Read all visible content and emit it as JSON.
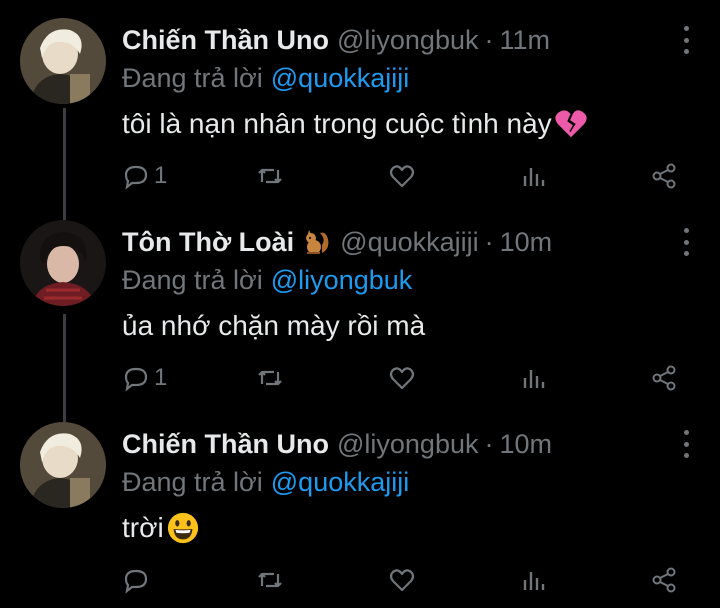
{
  "tweets": [
    {
      "display_name": "Chiến Thần Uno",
      "name_emoji": "",
      "handle": "@liyongbuk",
      "separator": "·",
      "time": "11m",
      "replying_label": "Đang trả lời",
      "replying_to": "@quokkajiji",
      "text": "tôi là nạn nhân trong cuộc tình này",
      "text_emoji": "broken-heart-emoji",
      "reply_count": "1",
      "avatar": "avatar-blonde-user"
    },
    {
      "display_name": "Tôn Thờ Loài",
      "name_emoji": "squirrel-emoji",
      "handle": "@quokkajiji",
      "separator": "·",
      "time": "10m",
      "replying_label": "Đang trả lời",
      "replying_to": "@liyongbuk",
      "text": "ủa nhớ chặn mày rồi mà",
      "text_emoji": "",
      "reply_count": "1",
      "avatar": "avatar-dark-hair-user"
    },
    {
      "display_name": "Chiến Thần Uno",
      "name_emoji": "",
      "handle": "@liyongbuk",
      "separator": "·",
      "time": "10m",
      "replying_label": "Đang trả lời",
      "replying_to": "@quokkajiji",
      "text": "trời",
      "text_emoji": "grinning-face-emoji",
      "reply_count": "",
      "avatar": "avatar-blonde-user"
    }
  ],
  "icons": {
    "reply": "reply-icon",
    "retweet": "retweet-icon",
    "like": "heart-icon",
    "stats": "analytics-icon",
    "share": "share-icon",
    "more": "more-options-icon"
  },
  "colors": {
    "background": "#000000",
    "primary_text": "#e7e9ea",
    "secondary_text": "#71767b",
    "link": "#1d9bf0",
    "thread_line": "#3a3d42"
  }
}
